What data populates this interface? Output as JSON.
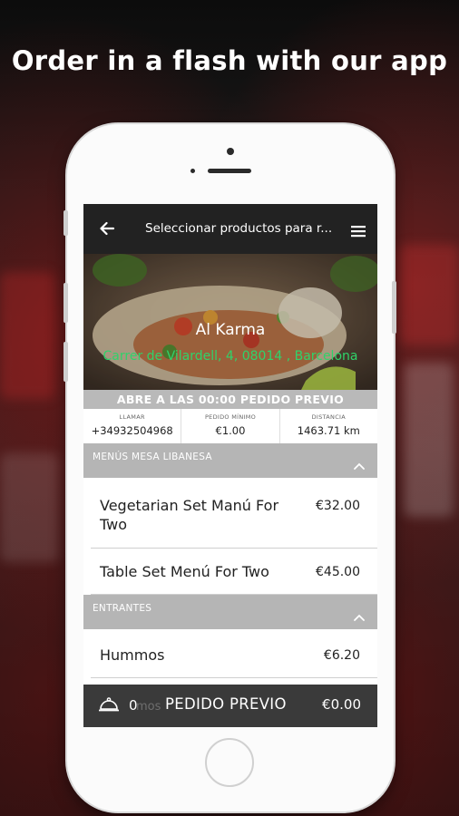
{
  "promo": {
    "headline": "Order in a flash with our app"
  },
  "app_bar": {
    "back_icon": "arrow-left-icon",
    "title": "Seleccionar productos para r...",
    "menu_icon": "hamburger-menu-icon"
  },
  "restaurant": {
    "name": "Al Karma",
    "address": "Carrer de Vilardell, 4, 08014 , Barcelona",
    "open_notice": "ABRE A LAS 00:00 PEDIDO PREVIO",
    "accent_color": "#2fd36a"
  },
  "info": {
    "call_label": "LLAMAR",
    "call_value": "+34932504968",
    "min_label": "PEDIDO MÍNIMO",
    "min_value": "€1.00",
    "dist_label": "DISTANCIA",
    "dist_value": "1463.71  km"
  },
  "sections": [
    {
      "title": "MENÚS MESA LIBANESA",
      "chevron_icon": "chevron-up-icon",
      "items": [
        {
          "name": "Vegetarian Set Manú For Two",
          "price": "€32.00"
        },
        {
          "name": "Table Set Menú For Two",
          "price": "€45.00"
        }
      ]
    },
    {
      "title": "ENTRANTES",
      "chevron_icon": "chevron-up-icon",
      "items": [
        {
          "name": "Hummos",
          "price": "€6.20"
        }
      ]
    }
  ],
  "bottom_bar": {
    "cloche_icon": "food-cloche-icon",
    "count": "0",
    "partial_hidden_text": "mos",
    "order_label": "PEDIDO PREVIO",
    "total": "€0.00"
  }
}
